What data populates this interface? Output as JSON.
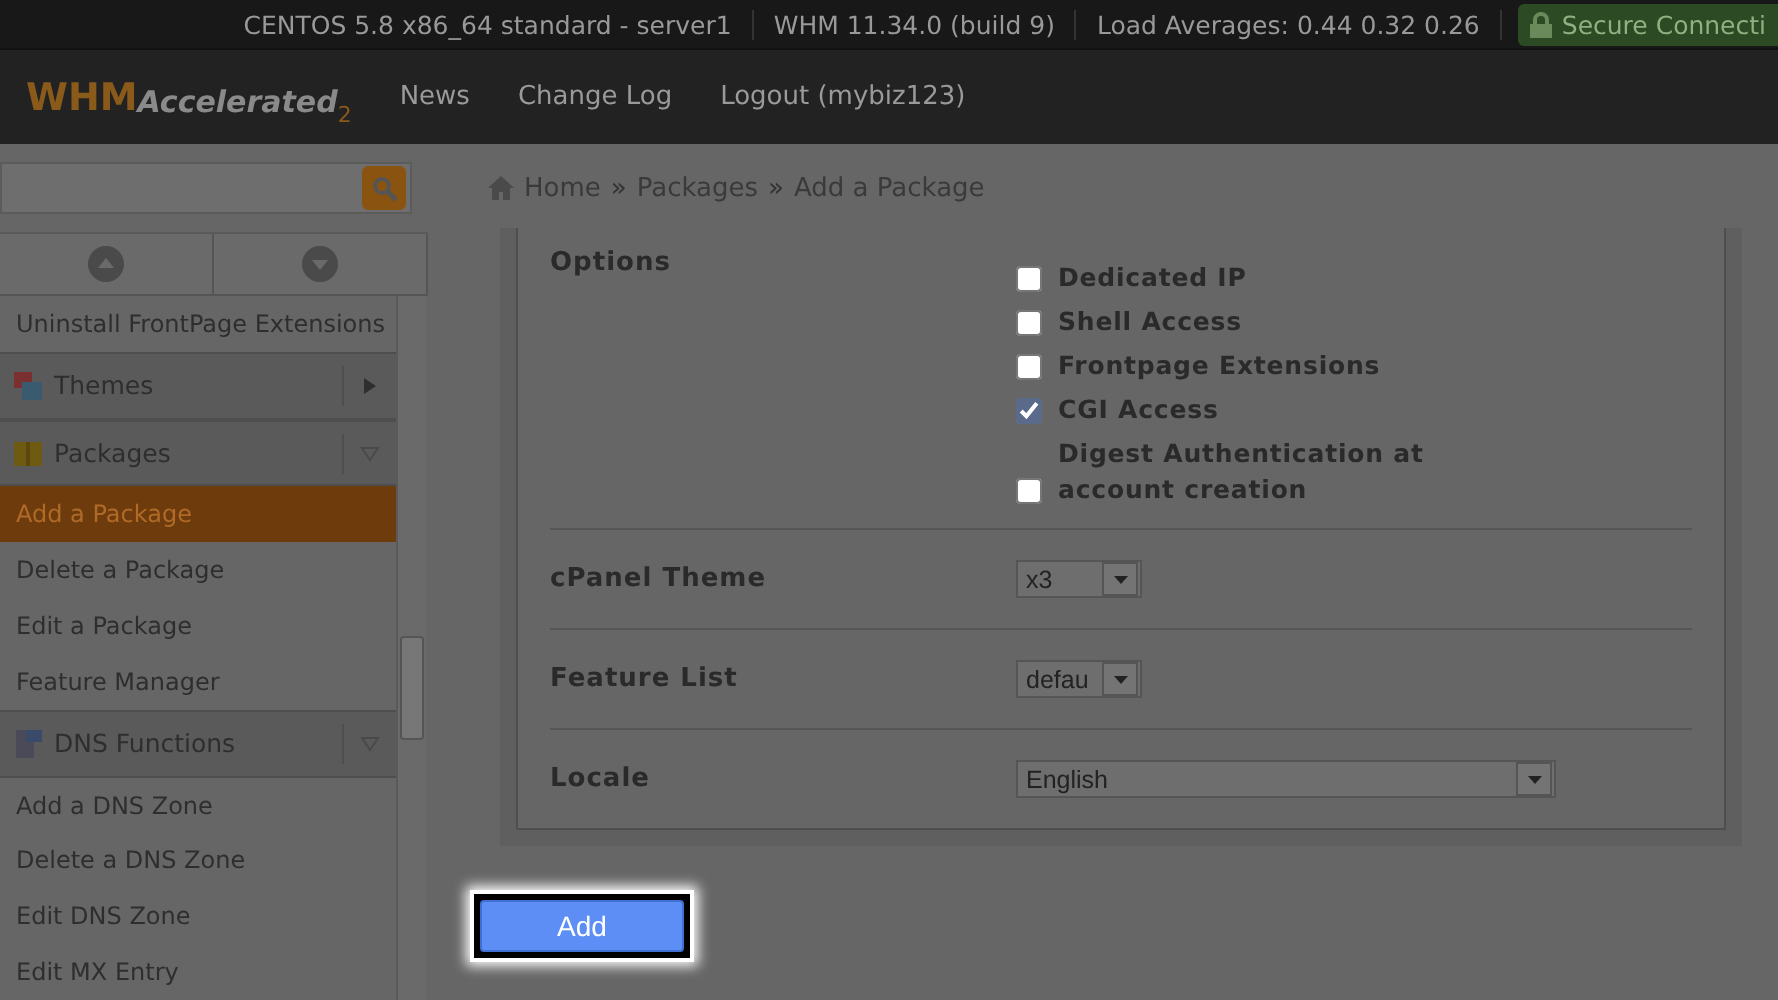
{
  "top_bar": {
    "items": [
      "CENTOS 5.8 x86_64 standard - server1",
      "WHM 11.34.0 (build 9)",
      "Load Averages: 0.44 0.32 0.26"
    ],
    "secure": "Secure Connecti"
  },
  "header": {
    "logo": {
      "main": "WHM",
      "sub": "Accelerated",
      "mark": "2"
    },
    "nav": [
      "News",
      "Change Log",
      "Logout (mybiz123)"
    ]
  },
  "breadcrumb": [
    {
      "kind": "link",
      "text": "Home"
    },
    {
      "kind": "separator",
      "text": "»"
    },
    {
      "kind": "link",
      "text": "Packages"
    },
    {
      "kind": "separator",
      "text": "»"
    },
    {
      "kind": "link",
      "text": "Add a Package"
    }
  ],
  "sidebar": [
    {
      "children": [
        {
          "label": "Uninstall FrontPage Extensions",
          "selected": false
        }
      ]
    },
    {
      "title": "Themes",
      "kind": "themes",
      "expanded": false
    },
    {
      "title": "Packages",
      "kind": "packages",
      "expanded": true,
      "children": [
        {
          "label": "Add a Package",
          "selected": true
        },
        {
          "label": "Delete a Package",
          "selected": false
        },
        {
          "label": "Edit a Package",
          "selected": false
        },
        {
          "label": "Feature Manager",
          "selected": false
        }
      ]
    },
    {
      "title": "DNS Functions",
      "kind": "dns",
      "expanded": true,
      "children": [
        {
          "label": "Add a DNS Zone",
          "selected": false
        },
        {
          "label": "Delete a DNS Zone",
          "selected": false
        },
        {
          "label": "Edit DNS Zone",
          "selected": false
        },
        {
          "label": "Edit MX Entry",
          "selected": false
        }
      ]
    }
  ],
  "form": {
    "options_label": "Options",
    "options": [
      {
        "label": "Dedicated IP",
        "checked": false
      },
      {
        "label": "Shell Access",
        "checked": false
      },
      {
        "label": "Frontpage Extensions",
        "checked": false
      },
      {
        "label": "CGI Access",
        "checked": true
      },
      {
        "label": "Digest Authentication at account creation",
        "checked": false
      }
    ],
    "selects": [
      {
        "label": "cPanel Theme",
        "value": "x3",
        "wide": false
      },
      {
        "label": "Feature List",
        "value": "defau",
        "wide": false
      },
      {
        "label": "Locale",
        "value": "English",
        "wide": true
      }
    ]
  },
  "submit": "Add"
}
